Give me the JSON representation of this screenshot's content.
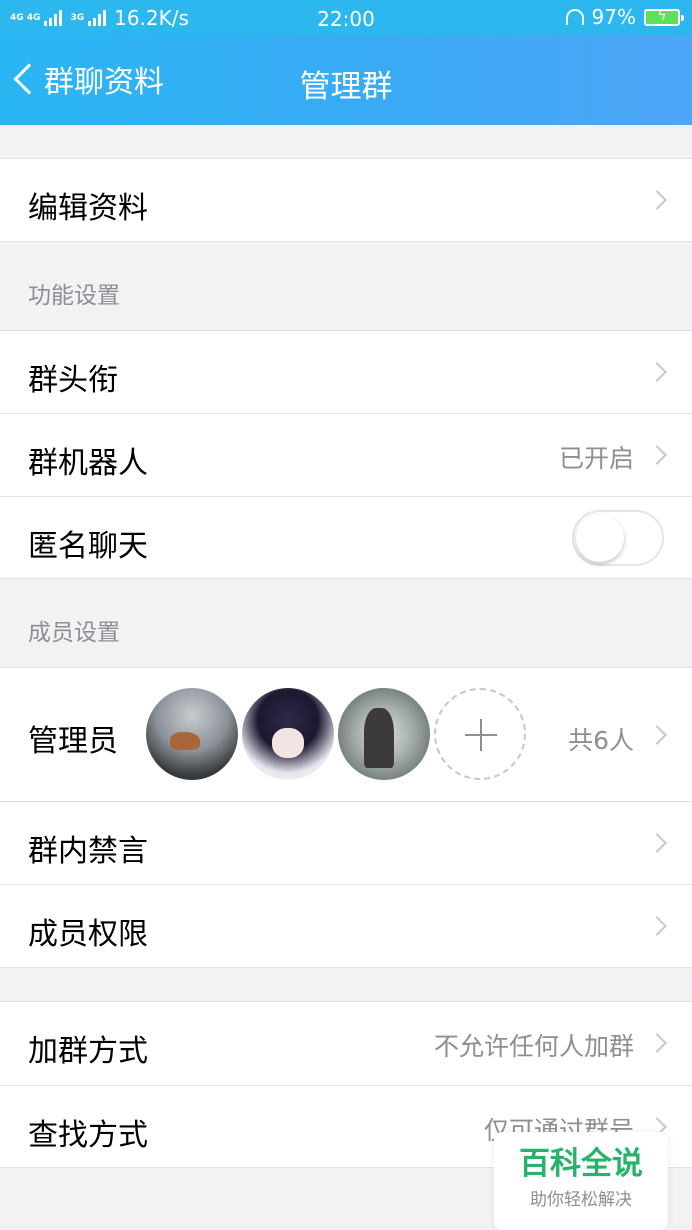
{
  "status_bar": {
    "network_1": "4G 4G",
    "network_2": "3G",
    "speed": "16.2K/s",
    "time": "22:00",
    "battery_percent": "97%"
  },
  "nav": {
    "back_label": "群聊资料",
    "title": "管理群"
  },
  "rows": {
    "edit_profile": "编辑资料",
    "features_header": "功能设置",
    "group_title": "群头衔",
    "group_robot": "群机器人",
    "group_robot_value": "已开启",
    "anonymous_chat": "匿名聊天",
    "anonymous_chat_enabled": false,
    "members_header": "成员设置",
    "admins": "管理员",
    "admins_count": "共6人",
    "mute_members": "群内禁言",
    "member_permissions": "成员权限",
    "join_method": "加群方式",
    "join_method_value": "不允许任何人加群",
    "search_method": "查找方式",
    "search_method_value": "仅可通过群号"
  },
  "watermark": {
    "title": "百科全说",
    "subtitle": "助你轻松解决"
  },
  "colors": {
    "nav_bar": "#3aaaf5",
    "status_bar": "#2cb7ef",
    "background": "#f2f2f5",
    "secondary_text": "#8e8e93",
    "watermark_green": "#27b46a"
  }
}
